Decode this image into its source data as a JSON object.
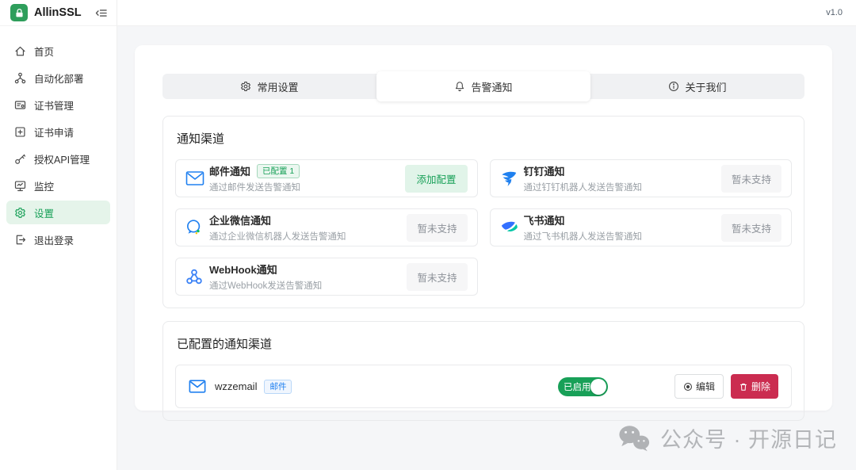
{
  "app": {
    "name": "AllinSSL",
    "version": "v1.0"
  },
  "colors": {
    "primary_green": "#18a058",
    "danger_red": "#cb2c50",
    "link_blue": "#2080f0",
    "sidebar_active_bg": "#e5f4ea",
    "page_bg": "#f5f6f8"
  },
  "sidebar": {
    "logo_text": "AllinSSL",
    "items": [
      {
        "label": "首页",
        "icon": "home-icon",
        "active": false
      },
      {
        "label": "自动化部署",
        "icon": "deploy-icon",
        "active": false
      },
      {
        "label": "证书管理",
        "icon": "certificate-icon",
        "active": false
      },
      {
        "label": "证书申请",
        "icon": "apply-icon",
        "active": false
      },
      {
        "label": "授权API管理",
        "icon": "api-key-icon",
        "active": false
      },
      {
        "label": "监控",
        "icon": "monitor-icon",
        "active": false
      },
      {
        "label": "设置",
        "icon": "settings-icon",
        "active": true
      },
      {
        "label": "退出登录",
        "icon": "logout-icon",
        "active": false
      }
    ]
  },
  "tabs": [
    {
      "label": "常用设置",
      "icon": "gear-icon",
      "active": false
    },
    {
      "label": "告警通知",
      "icon": "bell-icon",
      "active": true
    },
    {
      "label": "关于我们",
      "icon": "info-icon",
      "active": false
    }
  ],
  "channels_section": {
    "title": "通知渠道",
    "channels": [
      {
        "name": "邮件通知",
        "badge": "已配置 1",
        "desc": "通过邮件发送告警通知",
        "action": "添加配置",
        "icon": "email-icon"
      },
      {
        "name": "钉钉通知",
        "desc": "通过钉钉机器人发送告警通知",
        "action": "暂未支持",
        "icon": "dingtalk-icon"
      },
      {
        "name": "企业微信通知",
        "desc": "通过企业微信机器人发送告警通知",
        "action": "暂未支持",
        "icon": "wecom-icon"
      },
      {
        "name": "飞书通知",
        "desc": "通过飞书机器人发送告警通知",
        "action": "暂未支持",
        "icon": "feishu-icon"
      },
      {
        "name": "WebHook通知",
        "desc": "通过WebHook发送告警通知",
        "action": "暂未支持",
        "icon": "webhook-icon"
      }
    ]
  },
  "configured_section": {
    "title": "已配置的通知渠道",
    "items": [
      {
        "name": "wzzemail",
        "type_badge": "邮件",
        "toggle_label": "已启用",
        "enabled": true,
        "edit_label": "编辑",
        "delete_label": "删除"
      }
    ]
  },
  "watermark": {
    "text": "公众号 · 开源日记"
  }
}
